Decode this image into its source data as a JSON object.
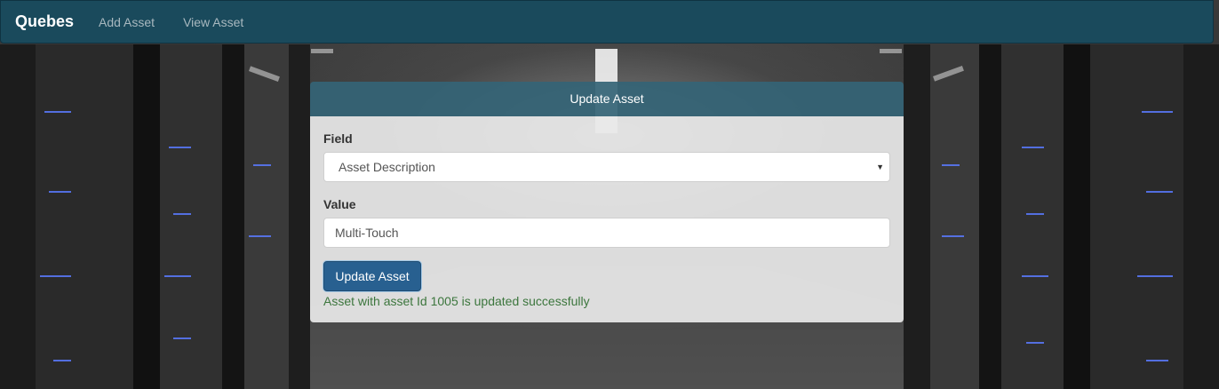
{
  "navbar": {
    "brand": "Quebes",
    "links": [
      {
        "label": "Add Asset"
      },
      {
        "label": "View Asset"
      }
    ],
    "background": "#1a4a5c"
  },
  "card": {
    "title": "Update Asset",
    "field_label": "Field",
    "field_selected": "Asset Description",
    "value_label": "Value",
    "value_input": "Multi-Touch",
    "submit_label": "Update Asset",
    "status_message": "Asset with asset Id 1005 is updated successfully",
    "colors": {
      "header": "#346476",
      "button": "#286090",
      "success_text": "#3c763d"
    }
  },
  "icons": {
    "select_caret": "chevron-down-icon"
  }
}
